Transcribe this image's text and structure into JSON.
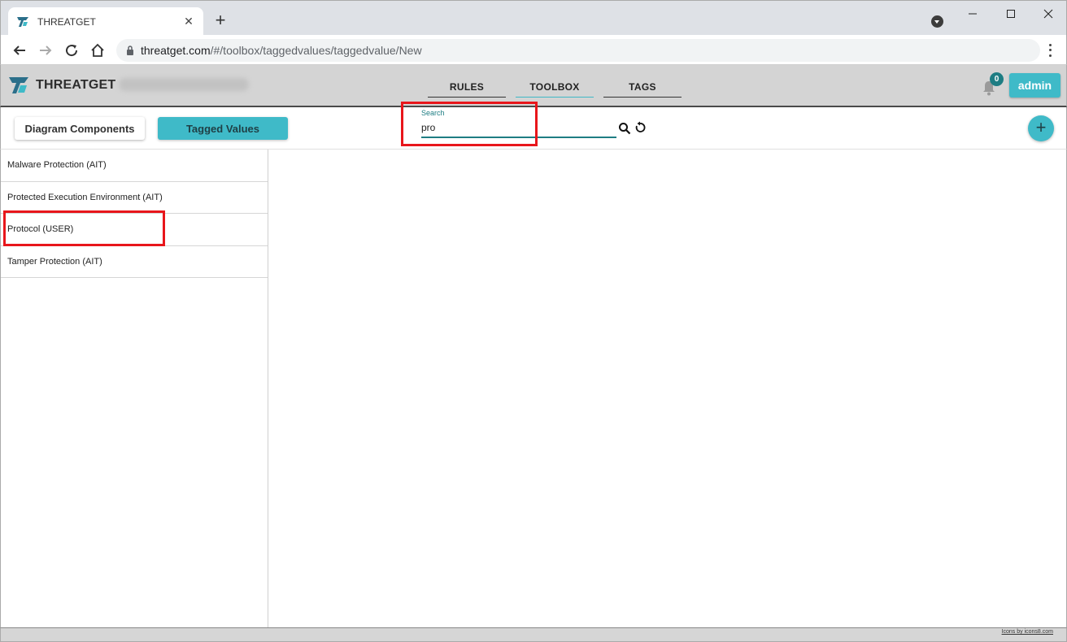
{
  "browser": {
    "tab_title": "THREATGET",
    "tab_favicon": "threatget-logo-icon",
    "url_host": "threatget.com",
    "url_path": "/#/toolbox/taggedvalues/taggedvalue/New"
  },
  "header": {
    "brand": "THREATGET",
    "nav": [
      {
        "label": "RULES",
        "active": false
      },
      {
        "label": "TOOLBOX",
        "active": true
      },
      {
        "label": "TAGS",
        "active": false
      }
    ],
    "notification_count": "0",
    "user_label": "admin"
  },
  "toolbar": {
    "diagram_components_label": "Diagram Components",
    "tagged_values_label": "Tagged Values",
    "search_label": "Search",
    "search_value": "pro"
  },
  "list": {
    "items": [
      "Malware Protection (AIT)",
      "Protected Execution Environment (AIT)",
      "Protocol (USER)",
      "Tamper Protection (AIT)"
    ]
  },
  "footer": {
    "credit": "Icons by icons8.com"
  },
  "colors": {
    "accent": "#3fbac8",
    "accent_dark": "#1e7d83",
    "highlight": "#e8161b",
    "header_bg": "#d4d4d4"
  }
}
